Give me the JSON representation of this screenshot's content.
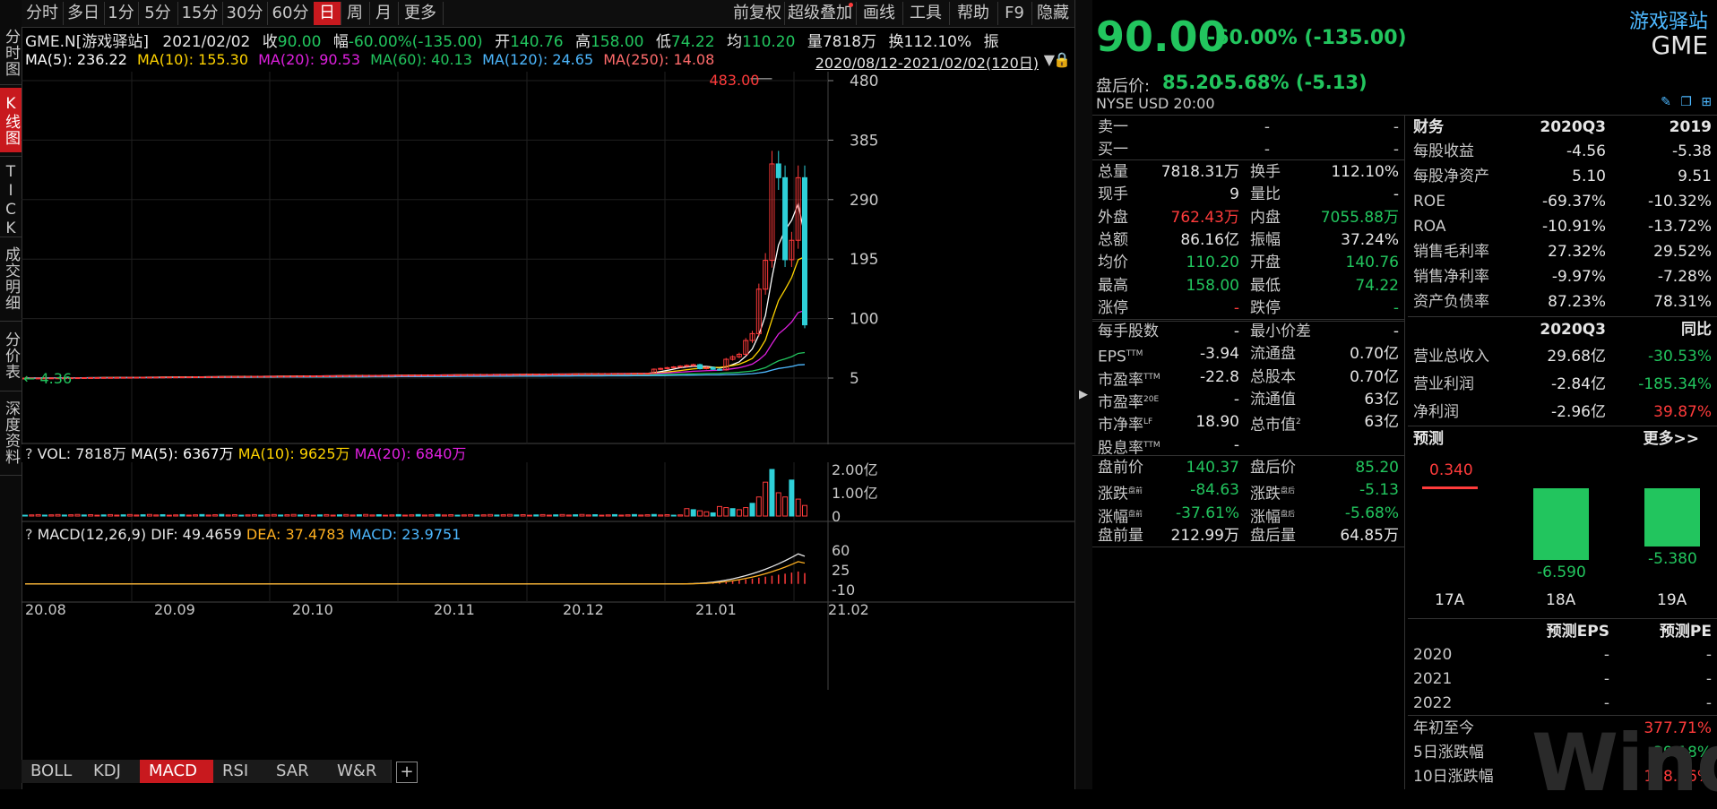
{
  "colors": {
    "accent": "#c8191e",
    "up": "#ff3b3b",
    "down": "#22c55e",
    "ma5": "#ffffff",
    "ma10": "#ffd400",
    "ma20": "#e020e0",
    "ma60": "#22c55e",
    "ma120": "#4db8ff",
    "ma250": "#ff6b6b"
  },
  "vtabs": [
    "分时图",
    "K线图",
    "TICK",
    "成交明细",
    "分价表",
    "深度资料"
  ],
  "toolbar": {
    "periods": [
      "分时",
      "多日",
      "1分",
      "5分",
      "15分",
      "30分",
      "60分",
      "日",
      "周",
      "月",
      "更多"
    ],
    "active": "日",
    "right": [
      "前复权",
      "超级叠加",
      "画线",
      "工具",
      "帮助",
      "F9",
      "隐藏"
    ]
  },
  "info": {
    "symbol": "GME.N[游戏驿站]",
    "date": "2021/02/02",
    "close_label": "收",
    "close": "90.00",
    "range_label": "幅",
    "range": "-60.00%(-135.00)",
    "open_label": "开",
    "open": "140.76",
    "high_label": "高",
    "high": "158.00",
    "low_label": "低",
    "low": "74.22",
    "avg_label": "均",
    "avg": "110.20",
    "vol_label": "量",
    "vol": "7818万",
    "turn_label": "换",
    "turn": "112.10%",
    "amp_label": "振"
  },
  "ma": {
    "ma5": "MA(5): 236.22",
    "ma10": "MA(10): 155.30",
    "ma20": "MA(20): 90.53",
    "ma60": "MA(60): 40.13",
    "ma120": "MA(120): 24.65",
    "ma250": "MA(250): 14.08",
    "range": "2020/08/12-2021/02/02(120日)"
  },
  "kchart": {
    "y_ticks": [
      "480",
      "385",
      "290",
      "195",
      "100",
      "5"
    ],
    "high_label": "483.00",
    "low_label": "4.36"
  },
  "vol": {
    "header": "VOL: 7818万",
    "ma5": "MA(5): 6367万",
    "ma10": "MA(10): 9625万",
    "ma20": "MA(20): 6840万",
    "ticks": [
      "2.00亿",
      "1.00亿",
      "0"
    ]
  },
  "macd": {
    "header": "MACD(12,26,9)",
    "dif": "DIF: 49.4659",
    "dea": "DEA: 37.4783",
    "macd": "MACD: 23.9751",
    "ticks": [
      "60",
      "25",
      "-10"
    ]
  },
  "x_labels": [
    "20.08",
    "20.09",
    "20.10",
    "20.11",
    "20.12",
    "21.01",
    "21.02"
  ],
  "bottom_tabs": [
    "BOLL",
    "KDJ",
    "MACD",
    "RSI",
    "SAR",
    "W&R"
  ],
  "bottom_active": "MACD",
  "quote": {
    "name": "游戏驿站",
    "ticker": "GME",
    "price": "90.00",
    "change": "-60.00% (-135.00)",
    "after_label": "盘后价:",
    "after_price": "85.20",
    "after_change": "-5.68% (-5.13)",
    "exchange": "NYSE",
    "currency": "USD",
    "time": "20:00"
  },
  "orderbook": [
    [
      "卖一",
      "-",
      "-"
    ],
    [
      "买一",
      "-",
      "-"
    ]
  ],
  "stats": [
    [
      "总量",
      "7818.31万",
      "换手",
      "112.10%"
    ],
    [
      "现手",
      "9",
      "量比",
      "-"
    ],
    [
      "外盘",
      "762.43万",
      "内盘",
      "7055.88万"
    ],
    [
      "总额",
      "86.16亿",
      "振幅",
      "37.24%"
    ],
    [
      "均价",
      "110.20",
      "开盘",
      "140.76"
    ],
    [
      "最高",
      "158.00",
      "最低",
      "74.22"
    ],
    [
      "涨停",
      "-",
      "跌停",
      "-"
    ]
  ],
  "stats2": [
    [
      "每手股数",
      "-",
      "最小价差",
      "-"
    ],
    [
      "EPS",
      "-3.94",
      "流通盘",
      "0.70亿"
    ],
    [
      "市盈率",
      "-22.8",
      "总股本",
      "0.70亿"
    ],
    [
      "市盈率",
      "-",
      "流通值",
      "63亿"
    ],
    [
      "市净率",
      "18.90",
      "总市值",
      "63亿"
    ],
    [
      "股息率",
      "-",
      "",
      ""
    ]
  ],
  "stats2_sup": [
    "",
    "TTM",
    "TTM",
    "20E",
    "LF",
    "TTM"
  ],
  "stats2_sup_right": [
    "",
    "",
    "",
    "",
    "2",
    ""
  ],
  "prepost": [
    [
      "盘前价",
      "140.37",
      "盘后价",
      "85.20"
    ],
    [
      "涨跌",
      "-84.63",
      "涨跌",
      "-5.13"
    ],
    [
      "涨幅",
      "-37.61%",
      "涨幅",
      "-5.68%"
    ],
    [
      "盘前量",
      "212.99万",
      "盘后量",
      "64.85万"
    ]
  ],
  "prepost_sup": [
    "",
    "盘前",
    "盘后"
  ],
  "finance": {
    "title": "财务",
    "col1": "2020Q3",
    "col2": "2019",
    "rows": [
      [
        "每股收益",
        "-4.56",
        "-5.38"
      ],
      [
        "每股净资产",
        "5.10",
        "9.51"
      ],
      [
        "ROE",
        "-69.37%",
        "-10.32%"
      ],
      [
        "ROA",
        "-10.91%",
        "-13.72%"
      ],
      [
        "销售毛利率",
        "27.32%",
        "29.52%"
      ],
      [
        "销售净利率",
        "-9.97%",
        "-7.28%"
      ],
      [
        "资产负债率",
        "87.23%",
        "78.31%"
      ]
    ]
  },
  "growth": {
    "col1": "2020Q3",
    "col2": "同比",
    "rows": [
      [
        "营业总收入",
        "29.68亿",
        "-30.53%"
      ],
      [
        "营业利润",
        "-2.84亿",
        "-185.34%"
      ],
      [
        "净利润",
        "-2.96亿",
        "39.87%"
      ]
    ]
  },
  "forecast": {
    "title": "预测",
    "more": "更多>>",
    "bars": [
      {
        "label": "17A",
        "value": 0.34,
        "text": "0.340"
      },
      {
        "label": "18A",
        "value": -6.59,
        "text": "-6.590"
      },
      {
        "label": "19A",
        "value": -5.38,
        "text": "-5.380"
      }
    ]
  },
  "eps_forecast": {
    "col1": "预测EPS",
    "col2": "预测PE",
    "rows": [
      [
        "2020",
        "-",
        "-"
      ],
      [
        "2021",
        "-",
        "-"
      ],
      [
        "2022",
        "-",
        "-"
      ]
    ]
  },
  "performance": [
    [
      "年初至今",
      "377.71%"
    ],
    [
      "5日涨跌幅",
      "-39.18%"
    ],
    [
      "10日涨跌幅",
      "128.66%"
    ]
  ],
  "watermark": "Wind"
}
